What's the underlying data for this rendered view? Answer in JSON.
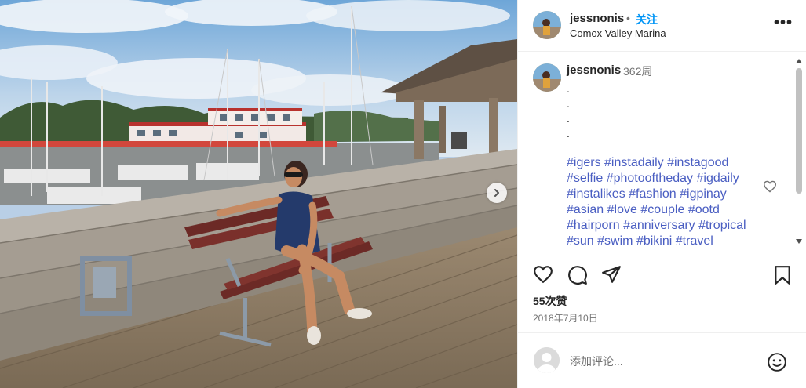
{
  "post": {
    "username": "jessnonis",
    "separator": "•",
    "follow_label": "关注",
    "location": "Comox Valley Marina",
    "more_label": "•••",
    "caption": {
      "username": "jessnonis",
      "time_ago": "362周",
      "dots": [
        ".",
        ".",
        ".",
        "."
      ],
      "hashtags": [
        [
          "#igers",
          "#instadaily",
          "#instagood"
        ],
        [
          "#selfie",
          "#photooftheday",
          "#igdaily"
        ],
        [
          "#instalikes",
          "#fashion",
          "#igpinay"
        ],
        [
          "#asian",
          "#love",
          "#couple",
          "#ootd"
        ],
        [
          "#hairporn",
          "#anniversary",
          "#tropical"
        ],
        [
          "#sun",
          "#swim",
          "#bikini",
          "#travel"
        ]
      ]
    },
    "likes": "55次赞",
    "date": "2018年7月10日",
    "comment_placeholder": "添加评论..."
  },
  "icons": {
    "next": "chevron-right-icon",
    "heart": "heart-icon",
    "comment": "comment-icon",
    "share": "share-icon",
    "save": "bookmark-icon",
    "emoji": "emoji-icon"
  },
  "colors": {
    "follow": "#0095f6",
    "hashtag": "#4a5ec2",
    "muted": "#737373"
  }
}
